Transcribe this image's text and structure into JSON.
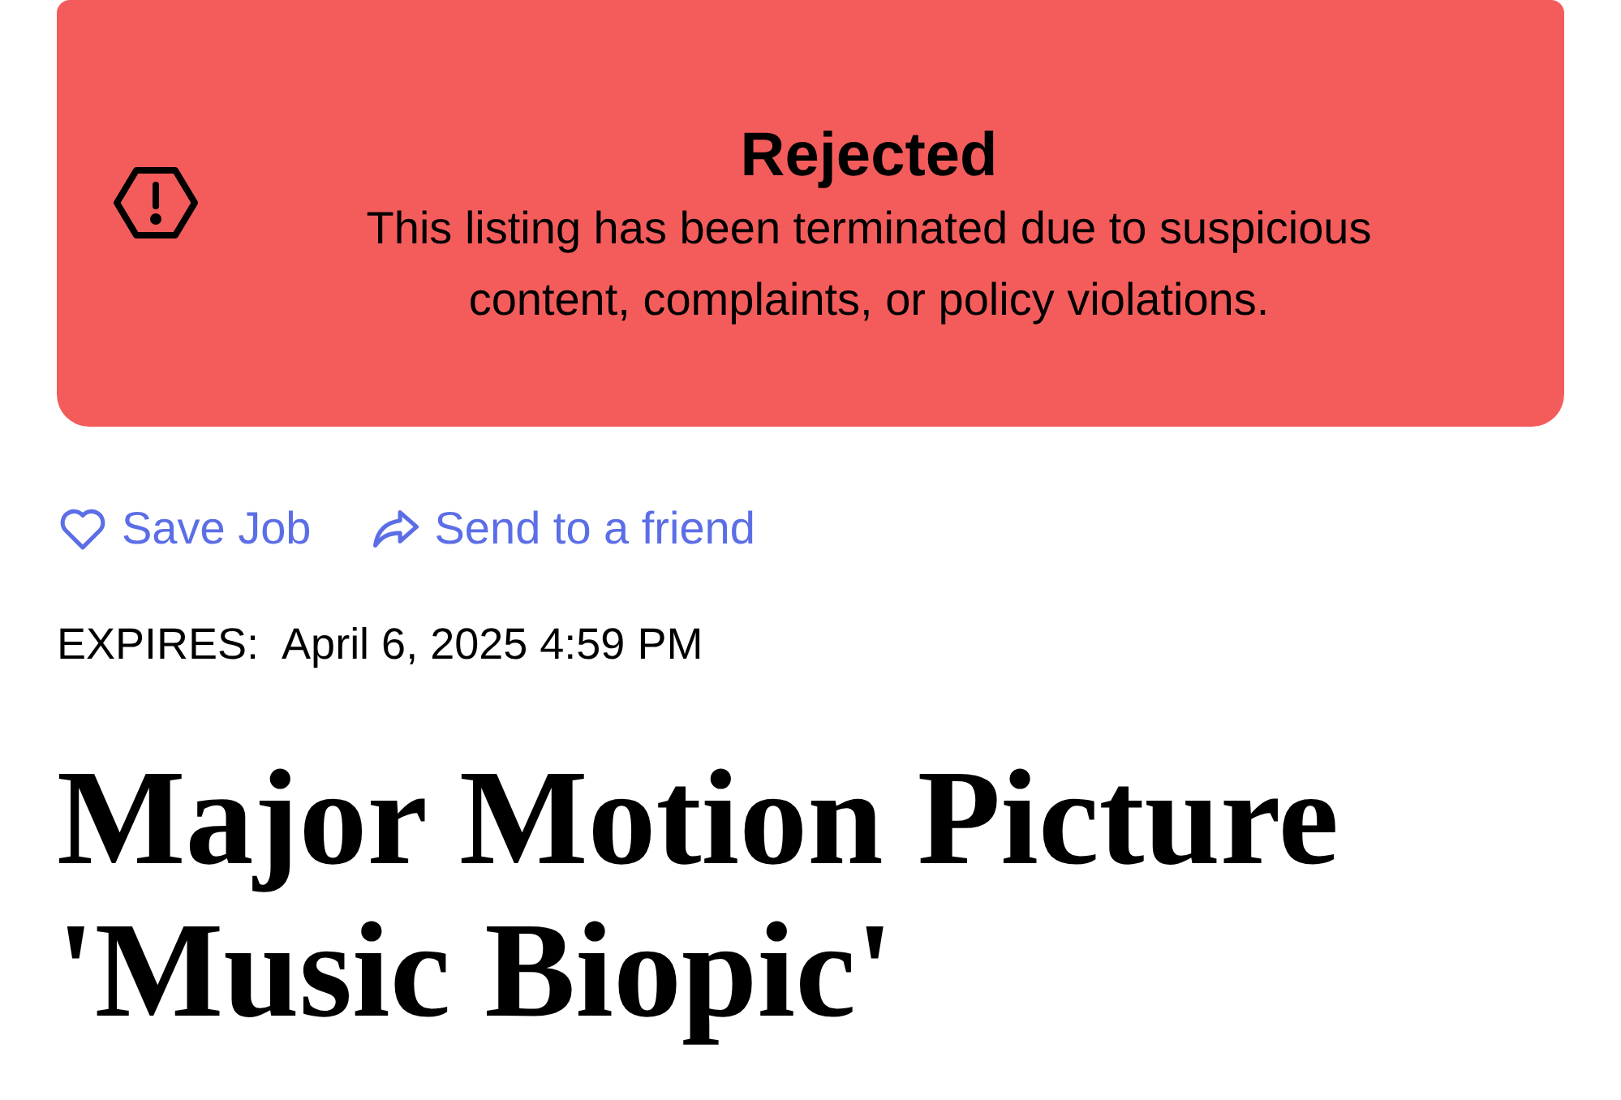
{
  "banner": {
    "title": "Rejected",
    "message": "This listing has been terminated due to suspicious content, complaints, or policy violations."
  },
  "actions": [
    {
      "kind": "save",
      "label": "Save Job"
    },
    {
      "kind": "share",
      "label": "Send to a friend"
    }
  ],
  "expires": {
    "label": "EXPIRES:",
    "value": "April 6, 2025 4:59 PM"
  },
  "job_title": "Major Motion Picture 'Music Biopic'"
}
